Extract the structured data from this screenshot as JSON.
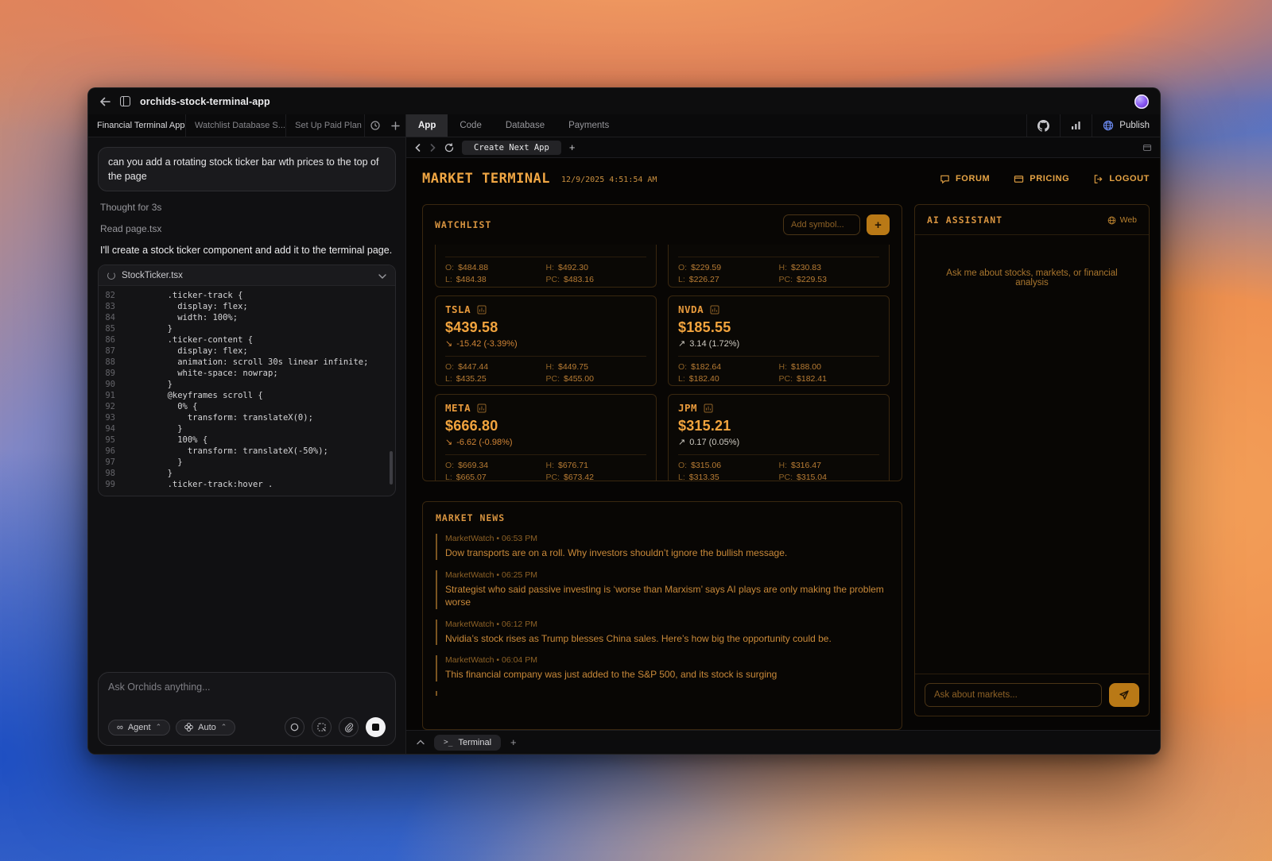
{
  "colors": {
    "accent_amber": "#f0a643",
    "amber_dim": "#8d6126",
    "negative_change": "#cf8436",
    "positive_change": "#cdc9c0",
    "add_button_amber": "#b97916",
    "avatar_purple": "#8b5cf6",
    "publish_globe_blue": "#6b8af0"
  },
  "window": {
    "title": "orchids-stock-terminal-app",
    "chat_tabs": [
      {
        "label": "Financial Terminal App",
        "state": "active"
      },
      {
        "label": "Watchlist Database S...",
        "state": ""
      },
      {
        "label": "Set Up Paid Plan",
        "state": ""
      }
    ],
    "app_tabs": [
      {
        "label": "App",
        "state": "active"
      },
      {
        "label": "Code",
        "state": ""
      },
      {
        "label": "Database",
        "state": ""
      },
      {
        "label": "Payments",
        "state": ""
      }
    ],
    "publish_label": "Publish"
  },
  "chat": {
    "user_message": "can you add a rotating stock ticker bar wth prices to the top of the page",
    "thought_label": "Thought for 3s",
    "tool_label": "Read page.tsx",
    "assistant_message": "I'll create a stock ticker component and add it to the terminal page.",
    "code_block": {
      "filename": "StockTicker.tsx",
      "lines": [
        {
          "n": "82",
          "text": "        .ticker-track {"
        },
        {
          "n": "83",
          "text": "          display: flex;"
        },
        {
          "n": "84",
          "text": "          width: 100%;"
        },
        {
          "n": "85",
          "text": "        }"
        },
        {
          "n": "86",
          "text": "        .ticker-content {"
        },
        {
          "n": "87",
          "text": "          display: flex;"
        },
        {
          "n": "88",
          "text": "          animation: scroll 30s linear infinite;"
        },
        {
          "n": "89",
          "text": "          white-space: nowrap;"
        },
        {
          "n": "90",
          "text": "        }"
        },
        {
          "n": "91",
          "text": "        @keyframes scroll {"
        },
        {
          "n": "92",
          "text": "          0% {"
        },
        {
          "n": "93",
          "text": "            transform: translateX(0);"
        },
        {
          "n": "94",
          "text": "          }"
        },
        {
          "n": "95",
          "text": "          100% {"
        },
        {
          "n": "96",
          "text": "            transform: translateX(-50%);"
        },
        {
          "n": "97",
          "text": "          }"
        },
        {
          "n": "98",
          "text": "        }"
        },
        {
          "n": "99",
          "text": "        .ticker-track:hover ."
        }
      ]
    },
    "composer": {
      "placeholder": "Ask Orchids anything...",
      "agent_label": "Agent",
      "mode_label": "Auto"
    }
  },
  "preview": {
    "nav_tab": "Create Next App",
    "header": {
      "title": "MARKET TERMINAL",
      "timestamp": "12/9/2025 4:51:54 AM",
      "forum_label": "FORUM",
      "pricing_label": "PRICING",
      "logout_label": "LOGOUT"
    },
    "watchlist": {
      "title": "WATCHLIST",
      "add_placeholder": "Add symbol...",
      "add_button": "+",
      "labels": {
        "o": "O:",
        "h": "H:",
        "l": "L:",
        "pc": "PC:"
      },
      "partial_cards": [
        {
          "o": "$484.88",
          "h": "$492.30",
          "l": "$484.38",
          "pc": "$483.16"
        },
        {
          "o": "$229.59",
          "h": "$230.83",
          "l": "$226.27",
          "pc": "$229.53"
        }
      ],
      "cards": [
        {
          "symbol": "TSLA",
          "price": "$439.58",
          "arrow": "↘",
          "change": "-15.42 (-3.39%)",
          "direction": "down",
          "o": "$447.44",
          "h": "$449.75",
          "l": "$435.25",
          "pc": "$455.00"
        },
        {
          "symbol": "NVDA",
          "price": "$185.55",
          "arrow": "↗",
          "change": "3.14 (1.72%)",
          "direction": "up",
          "o": "$182.64",
          "h": "$188.00",
          "l": "$182.40",
          "pc": "$182.41"
        },
        {
          "symbol": "META",
          "price": "$666.80",
          "arrow": "↘",
          "change": "-6.62 (-0.98%)",
          "direction": "down",
          "o": "$669.34",
          "h": "$676.71",
          "l": "$665.07",
          "pc": "$673.42"
        },
        {
          "symbol": "JPM",
          "price": "$315.21",
          "arrow": "↗",
          "change": "0.17 (0.05%)",
          "direction": "up",
          "o": "$315.06",
          "h": "$316.47",
          "l": "$313.35",
          "pc": "$315.04"
        }
      ]
    },
    "news": {
      "title": "MARKET NEWS",
      "separator": "•",
      "items": [
        {
          "source": "MarketWatch",
          "time": "06:53 PM",
          "headline": "Dow transports are on a roll. Why investors shouldn’t ignore the bullish message."
        },
        {
          "source": "MarketWatch",
          "time": "06:25 PM",
          "headline": "Strategist who said passive investing is ‘worse than Marxism’ says AI plays are only making the problem worse"
        },
        {
          "source": "MarketWatch",
          "time": "06:12 PM",
          "headline": "Nvidia’s stock rises as Trump blesses China sales. Here’s how big the opportunity could be."
        },
        {
          "source": "MarketWatch",
          "time": "06:04 PM",
          "headline": "This financial company was just added to the S&P 500, and its stock is surging"
        }
      ]
    },
    "assistant": {
      "title": "AI ASSISTANT",
      "web_label": "Web",
      "empty_message": "Ask me about stocks, markets, or financial analysis",
      "input_placeholder": "Ask about markets..."
    },
    "terminal_bar": {
      "prompt": ">_",
      "tab_label": "Terminal"
    }
  }
}
